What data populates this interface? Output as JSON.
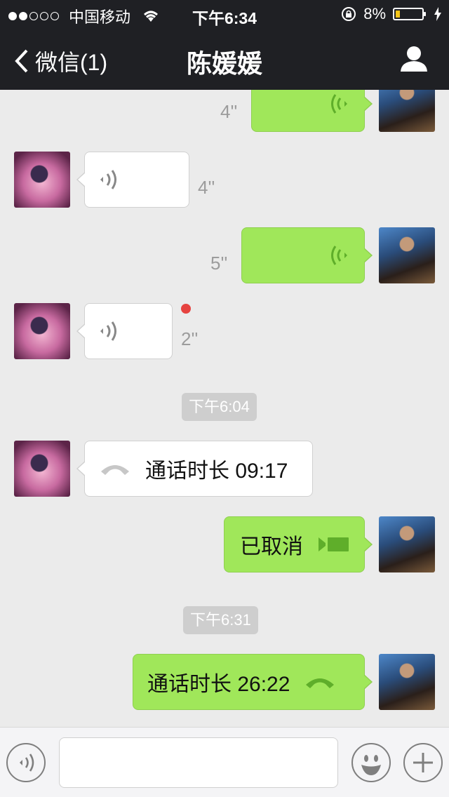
{
  "status_bar": {
    "carrier": "中国移动",
    "time": "下午6:34",
    "battery": "8%"
  },
  "nav": {
    "back_label": "微信(1)",
    "title": "陈媛媛"
  },
  "messages": [
    {
      "side": "out",
      "kind": "voice",
      "duration": "4''"
    },
    {
      "side": "in",
      "kind": "voice",
      "duration": "4''"
    },
    {
      "side": "out",
      "kind": "voice",
      "duration": "5''"
    },
    {
      "side": "in",
      "kind": "voice",
      "duration": "2''",
      "unread": true
    },
    {
      "side": "time",
      "text": "下午6:04"
    },
    {
      "side": "in",
      "kind": "call",
      "text": "通话时长 09:17"
    },
    {
      "side": "out",
      "kind": "video",
      "text": "已取消"
    },
    {
      "side": "time",
      "text": "下午6:31"
    },
    {
      "side": "out",
      "kind": "call",
      "text": "通话时长 26:22"
    }
  ],
  "colors": {
    "out_bubble": "#a0e75a",
    "in_bubble": "#ffffff",
    "nav_bg": "#1f2024",
    "unread_dot": "#e64340"
  },
  "icons": {
    "voice": "voice-wave-icon",
    "call": "phone-hangup-icon",
    "video": "video-camera-icon"
  }
}
